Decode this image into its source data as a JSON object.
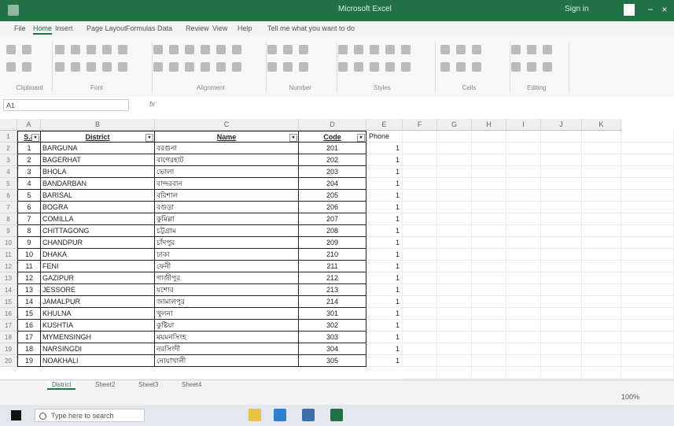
{
  "window": {
    "title": "",
    "document": "Microsoft Excel",
    "user": "Sign in"
  },
  "ribbon_tabs": [
    "File",
    "Home",
    "Insert",
    "Page Layout",
    "Formulas",
    "Data",
    "Review",
    "View",
    "Help",
    "Tell me what you want to do"
  ],
  "ribbon_groups": [
    "Clipboard",
    "Font",
    "Alignment",
    "Number",
    "Styles",
    "Cells",
    "Editing"
  ],
  "formula_bar": {
    "name_box": "A1",
    "fx": "fx"
  },
  "columns": [
    "A",
    "B",
    "C",
    "D",
    "E",
    "F",
    "G",
    "H",
    "I",
    "J",
    "K"
  ],
  "table": {
    "headers": [
      "S.#",
      "District",
      "Name",
      "Code"
    ],
    "rows": [
      {
        "sn": "1",
        "district": "BARGUNA",
        "name": "বরগুনা",
        "code": "201"
      },
      {
        "sn": "2",
        "district": "BAGERHAT",
        "name": "বাগেরহাট",
        "code": "202"
      },
      {
        "sn": "3",
        "district": "BHOLA",
        "name": "ভোলা",
        "code": "203"
      },
      {
        "sn": "4",
        "district": "BANDARBAN",
        "name": "বান্দরবান",
        "code": "204"
      },
      {
        "sn": "5",
        "district": "BARISAL",
        "name": "বরিশাল",
        "code": "205"
      },
      {
        "sn": "6",
        "district": "BOGRA",
        "name": "বগুড়া",
        "code": "206"
      },
      {
        "sn": "7",
        "district": "COMILLA",
        "name": "কুমিল্লা",
        "code": "207"
      },
      {
        "sn": "8",
        "district": "CHITTAGONG",
        "name": "চট্টগ্রাম",
        "code": "208"
      },
      {
        "sn": "9",
        "district": "CHANDPUR",
        "name": "চাঁদপুর",
        "code": "209"
      },
      {
        "sn": "10",
        "district": "DHAKA",
        "name": "ঢাকা",
        "code": "210"
      },
      {
        "sn": "11",
        "district": "FENI",
        "name": "ফেনী",
        "code": "211"
      },
      {
        "sn": "12",
        "district": "GAZIPUR",
        "name": "গাজীপুর",
        "code": "212"
      },
      {
        "sn": "13",
        "district": "JESSORE",
        "name": "যশোর",
        "code": "213"
      },
      {
        "sn": "14",
        "district": "JAMALPUR",
        "name": "জামালপুর",
        "code": "214"
      },
      {
        "sn": "15",
        "district": "KHULNA",
        "name": "খুলনা",
        "code": "301"
      },
      {
        "sn": "16",
        "district": "KUSHTIA",
        "name": "কুষ্টিয়া",
        "code": "302"
      },
      {
        "sn": "17",
        "district": "MYMENSINGH",
        "name": "ময়মনসিংহ",
        "code": "303"
      },
      {
        "sn": "18",
        "district": "NARSINGDI",
        "name": "নরসিংদী",
        "code": "304"
      },
      {
        "sn": "19",
        "district": "NOAKHALI",
        "name": "নোয়াখালী",
        "code": "305"
      }
    ]
  },
  "phone_col": {
    "header": "Phone",
    "values": [
      "1",
      "1",
      "1",
      "1",
      "1",
      "1",
      "1",
      "1",
      "1",
      "1",
      "1",
      "1",
      "1",
      "1",
      "1",
      "1",
      "1",
      "1",
      "1"
    ]
  },
  "row_numbers": [
    "1",
    "2",
    "3",
    "4",
    "5",
    "6",
    "7",
    "8",
    "9",
    "10",
    "11",
    "12",
    "13",
    "14",
    "15",
    "16",
    "17",
    "18",
    "19",
    "20"
  ],
  "sheets": [
    "District",
    "Sheet2",
    "Sheet3",
    "Sheet4"
  ],
  "status": {
    "zoom": "100%"
  },
  "taskbar": {
    "search_placeholder": "Type here to search",
    "tray_text": ""
  },
  "colors": {
    "accent": "#217346",
    "taskbar": "#e4e8ee"
  }
}
